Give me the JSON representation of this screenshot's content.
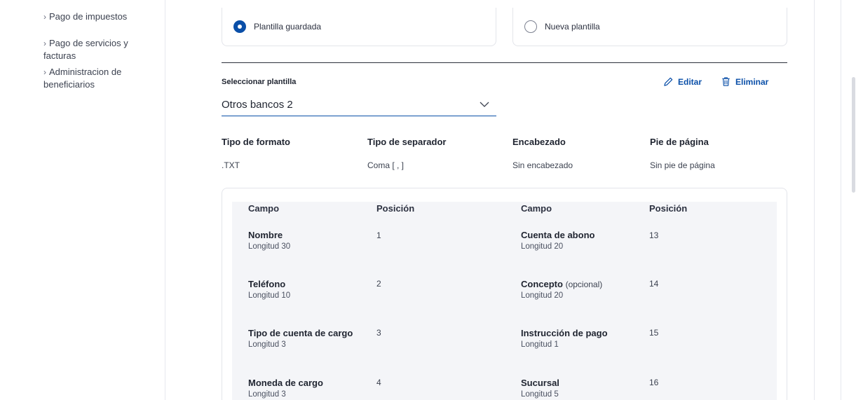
{
  "sidebar": {
    "items": [
      {
        "label": "Pago de impuestos"
      },
      {
        "label": "Pago de servicios y facturas"
      },
      {
        "label": "Administracion de beneficiarios"
      }
    ]
  },
  "template_choice": {
    "saved": {
      "label": "Plantilla guardada",
      "selected": true
    },
    "new": {
      "label": "Nueva plantilla",
      "selected": false
    }
  },
  "select_template": {
    "label": "Seleccionar plantilla",
    "value": "Otros bancos 2"
  },
  "actions": {
    "edit_label": "Editar",
    "delete_label": "Eliminar"
  },
  "meta": [
    {
      "header": "Tipo de formato",
      "value": ".TXT"
    },
    {
      "header": "Tipo de separador",
      "value": "Coma [ , ]"
    },
    {
      "header": "Encabezado",
      "value": "Sin encabezado"
    },
    {
      "header": "Pie de página",
      "value": "Sin pie de página"
    }
  ],
  "table": {
    "headers": {
      "field": "Campo",
      "position": "Posición"
    },
    "left": [
      {
        "name": "Nombre",
        "length": "Longitud 30",
        "position": "1"
      },
      {
        "name": "Teléfono",
        "length": "Longitud 10",
        "position": "2"
      },
      {
        "name": "Tipo de cuenta de cargo",
        "length": "Longitud 3",
        "position": "3"
      },
      {
        "name": "Moneda de cargo",
        "length": "Longitud 3",
        "position": "4"
      }
    ],
    "right": [
      {
        "name": "Cuenta de abono",
        "optional": "",
        "length": "Longitud 20",
        "position": "13"
      },
      {
        "name": "Concepto",
        "optional": "(opcional)",
        "length": "Longitud 20",
        "position": "14"
      },
      {
        "name": "Instrucción de pago",
        "optional": "",
        "length": "Longitud 1",
        "position": "15"
      },
      {
        "name": "Sucursal",
        "optional": "",
        "length": "Longitud 5",
        "position": "16"
      }
    ]
  },
  "colors": {
    "accent": "#0a4fa8"
  }
}
